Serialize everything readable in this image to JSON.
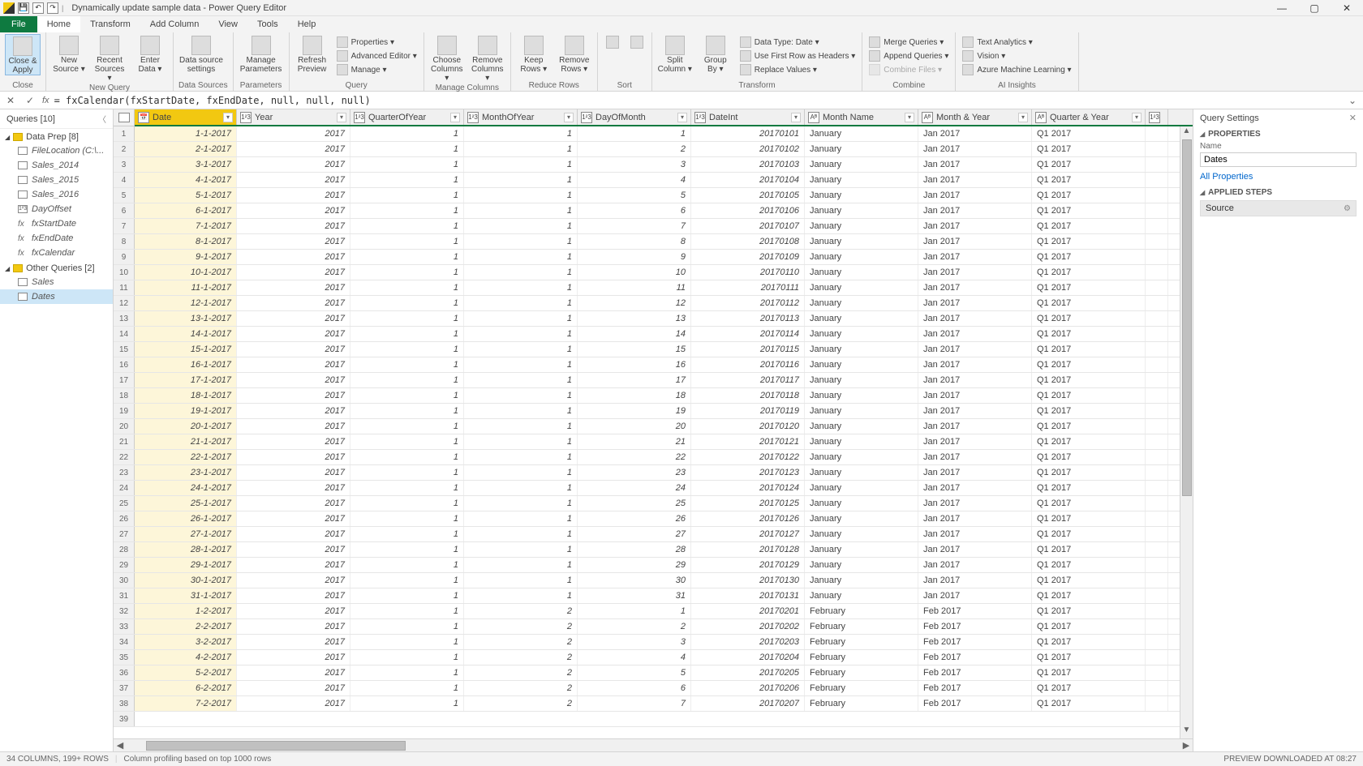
{
  "title": "Dynamically update sample data - Power Query Editor",
  "menu": {
    "file": "File",
    "items": [
      "Home",
      "Transform",
      "Add Column",
      "View",
      "Tools",
      "Help"
    ],
    "active": 0
  },
  "ribbon": {
    "close": {
      "big": "Close &\nApply",
      "group": "Close"
    },
    "newq": {
      "btns": [
        "New\nSource",
        "Recent\nSources",
        "Enter\nData"
      ],
      "group": "New Query"
    },
    "ds": {
      "btn": "Data source\nsettings",
      "group": "Data Sources"
    },
    "param": {
      "btn": "Manage\nParameters",
      "group": "Parameters"
    },
    "query": {
      "btn": "Refresh\nPreview",
      "items": [
        "Properties",
        "Advanced Editor",
        "Manage"
      ],
      "group": "Query"
    },
    "cols": {
      "btns": [
        "Choose\nColumns",
        "Remove\nColumns"
      ],
      "group": "Manage Columns"
    },
    "rows": {
      "btns": [
        "Keep\nRows",
        "Remove\nRows"
      ],
      "group": "Reduce Rows"
    },
    "sort": {
      "group": "Sort"
    },
    "trans": {
      "btns": [
        "Split\nColumn",
        "Group\nBy"
      ],
      "items": [
        "Data Type: Date",
        "Use First Row as Headers",
        "Replace Values"
      ],
      "group": "Transform"
    },
    "combine": {
      "items": [
        "Merge Queries",
        "Append Queries",
        "Combine Files"
      ],
      "group": "Combine"
    },
    "ai": {
      "items": [
        "Text Analytics",
        "Vision",
        "Azure Machine Learning"
      ],
      "group": "AI Insights"
    }
  },
  "formula": "= fxCalendar(fxStartDate, fxEndDate, null, null, null)",
  "queries": {
    "title": "Queries [10]",
    "groups": [
      {
        "name": "Data Prep [8]",
        "items": [
          {
            "n": "FileLocation (C:\\...",
            "t": "table"
          },
          {
            "n": "Sales_2014",
            "t": "table"
          },
          {
            "n": "Sales_2015",
            "t": "table"
          },
          {
            "n": "Sales_2016",
            "t": "table"
          },
          {
            "n": "DayOffset",
            "t": "num"
          },
          {
            "n": "fxStartDate",
            "t": "fx"
          },
          {
            "n": "fxEndDate",
            "t": "fx"
          },
          {
            "n": "fxCalendar",
            "t": "fx"
          }
        ]
      },
      {
        "name": "Other Queries [2]",
        "items": [
          {
            "n": "Sales",
            "t": "table"
          },
          {
            "n": "Dates",
            "t": "table",
            "sel": true
          }
        ]
      }
    ]
  },
  "columns": [
    {
      "name": "Date",
      "type": "date",
      "w": "w-date",
      "sel": true
    },
    {
      "name": "Year",
      "type": "num",
      "w": "w-year"
    },
    {
      "name": "QuarterOfYear",
      "type": "num",
      "w": "w-q"
    },
    {
      "name": "MonthOfYear",
      "type": "num",
      "w": "w-moy"
    },
    {
      "name": "DayOfMonth",
      "type": "num",
      "w": "w-dom"
    },
    {
      "name": "DateInt",
      "type": "num",
      "w": "w-dint"
    },
    {
      "name": "Month Name",
      "type": "text",
      "w": "w-mn"
    },
    {
      "name": "Month & Year",
      "type": "text",
      "w": "w-mny"
    },
    {
      "name": "Quarter & Year",
      "type": "text",
      "w": "w-qy"
    }
  ],
  "rows": [
    [
      "1-1-2017",
      "2017",
      "1",
      "1",
      "1",
      "20170101",
      "January",
      "Jan 2017",
      "Q1 2017"
    ],
    [
      "2-1-2017",
      "2017",
      "1",
      "1",
      "2",
      "20170102",
      "January",
      "Jan 2017",
      "Q1 2017"
    ],
    [
      "3-1-2017",
      "2017",
      "1",
      "1",
      "3",
      "20170103",
      "January",
      "Jan 2017",
      "Q1 2017"
    ],
    [
      "4-1-2017",
      "2017",
      "1",
      "1",
      "4",
      "20170104",
      "January",
      "Jan 2017",
      "Q1 2017"
    ],
    [
      "5-1-2017",
      "2017",
      "1",
      "1",
      "5",
      "20170105",
      "January",
      "Jan 2017",
      "Q1 2017"
    ],
    [
      "6-1-2017",
      "2017",
      "1",
      "1",
      "6",
      "20170106",
      "January",
      "Jan 2017",
      "Q1 2017"
    ],
    [
      "7-1-2017",
      "2017",
      "1",
      "1",
      "7",
      "20170107",
      "January",
      "Jan 2017",
      "Q1 2017"
    ],
    [
      "8-1-2017",
      "2017",
      "1",
      "1",
      "8",
      "20170108",
      "January",
      "Jan 2017",
      "Q1 2017"
    ],
    [
      "9-1-2017",
      "2017",
      "1",
      "1",
      "9",
      "20170109",
      "January",
      "Jan 2017",
      "Q1 2017"
    ],
    [
      "10-1-2017",
      "2017",
      "1",
      "1",
      "10",
      "20170110",
      "January",
      "Jan 2017",
      "Q1 2017"
    ],
    [
      "11-1-2017",
      "2017",
      "1",
      "1",
      "11",
      "20170111",
      "January",
      "Jan 2017",
      "Q1 2017"
    ],
    [
      "12-1-2017",
      "2017",
      "1",
      "1",
      "12",
      "20170112",
      "January",
      "Jan 2017",
      "Q1 2017"
    ],
    [
      "13-1-2017",
      "2017",
      "1",
      "1",
      "13",
      "20170113",
      "January",
      "Jan 2017",
      "Q1 2017"
    ],
    [
      "14-1-2017",
      "2017",
      "1",
      "1",
      "14",
      "20170114",
      "January",
      "Jan 2017",
      "Q1 2017"
    ],
    [
      "15-1-2017",
      "2017",
      "1",
      "1",
      "15",
      "20170115",
      "January",
      "Jan 2017",
      "Q1 2017"
    ],
    [
      "16-1-2017",
      "2017",
      "1",
      "1",
      "16",
      "20170116",
      "January",
      "Jan 2017",
      "Q1 2017"
    ],
    [
      "17-1-2017",
      "2017",
      "1",
      "1",
      "17",
      "20170117",
      "January",
      "Jan 2017",
      "Q1 2017"
    ],
    [
      "18-1-2017",
      "2017",
      "1",
      "1",
      "18",
      "20170118",
      "January",
      "Jan 2017",
      "Q1 2017"
    ],
    [
      "19-1-2017",
      "2017",
      "1",
      "1",
      "19",
      "20170119",
      "January",
      "Jan 2017",
      "Q1 2017"
    ],
    [
      "20-1-2017",
      "2017",
      "1",
      "1",
      "20",
      "20170120",
      "January",
      "Jan 2017",
      "Q1 2017"
    ],
    [
      "21-1-2017",
      "2017",
      "1",
      "1",
      "21",
      "20170121",
      "January",
      "Jan 2017",
      "Q1 2017"
    ],
    [
      "22-1-2017",
      "2017",
      "1",
      "1",
      "22",
      "20170122",
      "January",
      "Jan 2017",
      "Q1 2017"
    ],
    [
      "23-1-2017",
      "2017",
      "1",
      "1",
      "23",
      "20170123",
      "January",
      "Jan 2017",
      "Q1 2017"
    ],
    [
      "24-1-2017",
      "2017",
      "1",
      "1",
      "24",
      "20170124",
      "January",
      "Jan 2017",
      "Q1 2017"
    ],
    [
      "25-1-2017",
      "2017",
      "1",
      "1",
      "25",
      "20170125",
      "January",
      "Jan 2017",
      "Q1 2017"
    ],
    [
      "26-1-2017",
      "2017",
      "1",
      "1",
      "26",
      "20170126",
      "January",
      "Jan 2017",
      "Q1 2017"
    ],
    [
      "27-1-2017",
      "2017",
      "1",
      "1",
      "27",
      "20170127",
      "January",
      "Jan 2017",
      "Q1 2017"
    ],
    [
      "28-1-2017",
      "2017",
      "1",
      "1",
      "28",
      "20170128",
      "January",
      "Jan 2017",
      "Q1 2017"
    ],
    [
      "29-1-2017",
      "2017",
      "1",
      "1",
      "29",
      "20170129",
      "January",
      "Jan 2017",
      "Q1 2017"
    ],
    [
      "30-1-2017",
      "2017",
      "1",
      "1",
      "30",
      "20170130",
      "January",
      "Jan 2017",
      "Q1 2017"
    ],
    [
      "31-1-2017",
      "2017",
      "1",
      "1",
      "31",
      "20170131",
      "January",
      "Jan 2017",
      "Q1 2017"
    ],
    [
      "1-2-2017",
      "2017",
      "1",
      "2",
      "1",
      "20170201",
      "February",
      "Feb 2017",
      "Q1 2017"
    ],
    [
      "2-2-2017",
      "2017",
      "1",
      "2",
      "2",
      "20170202",
      "February",
      "Feb 2017",
      "Q1 2017"
    ],
    [
      "3-2-2017",
      "2017",
      "1",
      "2",
      "3",
      "20170203",
      "February",
      "Feb 2017",
      "Q1 2017"
    ],
    [
      "4-2-2017",
      "2017",
      "1",
      "2",
      "4",
      "20170204",
      "February",
      "Feb 2017",
      "Q1 2017"
    ],
    [
      "5-2-2017",
      "2017",
      "1",
      "2",
      "5",
      "20170205",
      "February",
      "Feb 2017",
      "Q1 2017"
    ],
    [
      "6-2-2017",
      "2017",
      "1",
      "2",
      "6",
      "20170206",
      "February",
      "Feb 2017",
      "Q1 2017"
    ],
    [
      "7-2-2017",
      "2017",
      "1",
      "2",
      "7",
      "20170207",
      "February",
      "Feb 2017",
      "Q1 2017"
    ]
  ],
  "settings": {
    "title": "Query Settings",
    "properties": "PROPERTIES",
    "nameLabel": "Name",
    "name": "Dates",
    "allprops": "All Properties",
    "steps": "APPLIED STEPS",
    "step": "Source"
  },
  "status": {
    "left1": "34 COLUMNS, 199+ ROWS",
    "left2": "Column profiling based on top 1000 rows",
    "right": "PREVIEW DOWNLOADED AT 08:27"
  }
}
